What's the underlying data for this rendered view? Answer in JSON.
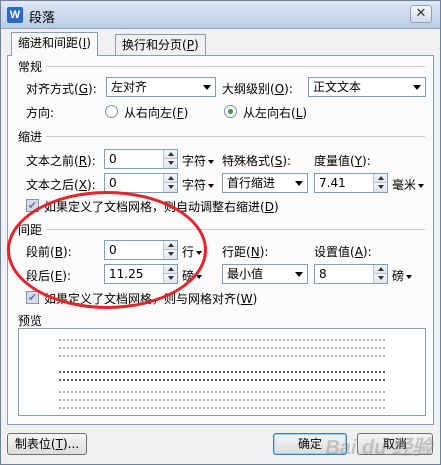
{
  "window": {
    "title": "段落",
    "app_icon": "W",
    "close_glyph": "✕"
  },
  "tabs": [
    {
      "label": "缩进和间距",
      "hotkey": "I",
      "active": true
    },
    {
      "label": "换行和分页",
      "hotkey": "P",
      "active": false
    }
  ],
  "general": {
    "heading": "常规",
    "alignment_label": "对齐方式",
    "alignment_hotkey": "G",
    "alignment_value": "左对齐",
    "outline_label": "大纲级别",
    "outline_hotkey": "O",
    "outline_value": "正文文本",
    "direction_label": "方向:",
    "rtl_label": "从右向左",
    "rtl_hotkey": "F",
    "ltr_label": "从左向右",
    "ltr_hotkey": "L",
    "direction_selected": "ltr"
  },
  "indent": {
    "heading": "缩进",
    "before_label": "文本之前",
    "before_hotkey": "R",
    "before_value": "0",
    "before_unit": "字符",
    "after_label": "文本之后",
    "after_hotkey": "X",
    "after_value": "0",
    "after_unit": "字符",
    "special_label": "特殊格式",
    "special_hotkey": "S",
    "special_value": "首行缩进",
    "measure_label": "度量值",
    "measure_hotkey": "Y",
    "measure_value": "7.41",
    "measure_unit": "毫米",
    "grid_check_label": "如果定义了文档网格，则自动调整右缩进",
    "grid_check_hotkey": "D",
    "grid_checked": true
  },
  "spacing": {
    "heading": "间距",
    "before_label": "段前",
    "before_hotkey": "B",
    "before_value": "0",
    "before_unit": "行",
    "after_label": "段后",
    "after_hotkey": "E",
    "after_value": "11.25",
    "after_unit": "磅",
    "line_label": "行距",
    "line_hotkey": "N",
    "line_value": "最小值",
    "setting_label": "设置值",
    "setting_hotkey": "A",
    "setting_value": "8",
    "setting_unit": "磅",
    "grid_check_label": "如果定义了文档网格，则与网格对齐",
    "grid_check_hotkey": "W",
    "grid_checked": true
  },
  "preview": {
    "heading": "预览"
  },
  "buttons": {
    "tabs_label": "制表位",
    "tabs_hotkey": "T",
    "ok_label": "确定",
    "cancel_label": "取消"
  },
  "watermark": "Bai du 经验",
  "colors": {
    "annotation_ring": "#e5232b",
    "titlebar": "#c8d8ee"
  }
}
